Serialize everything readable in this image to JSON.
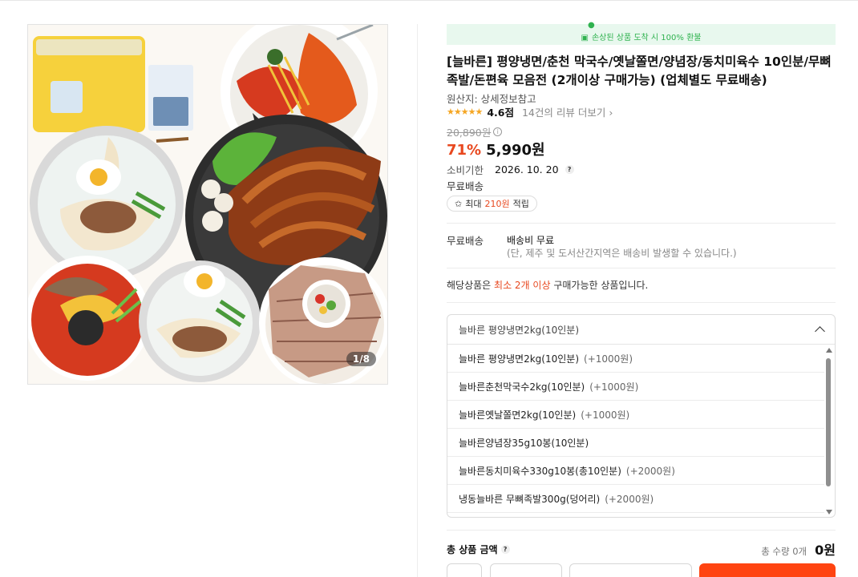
{
  "banner": {
    "text": "손상된 상품 도착 시 100% 환불",
    "icon": "bag-icon"
  },
  "product": {
    "title": "[늘바른] 평양냉면/춘천 막국수/옛날쫄면/양념장/동치미육수 10인분/무뼈 족발/돈편육 모음전 (2개이상 구매가능) (업체별도 무료배송)",
    "origin": "원산지: 상세정보참고",
    "rating": "4.6점",
    "rating_value": 4.6,
    "reviews": "14건의 리뷰 더보기",
    "original_price": "20,890원",
    "discount": "71%",
    "price": "5,990원",
    "expiry_label": "소비기한",
    "expiry_value": "2026. 10. 20",
    "free_shipping": "무료배송",
    "points_prefix": "최대",
    "points_amount": "210원",
    "points_suffix": "적립"
  },
  "gallery": {
    "counter": "1/8"
  },
  "shipping": {
    "label": "무료배송",
    "fee": "배송비 무료",
    "note": "(단, 제주 및 도서산간지역은 배송비 발생할 수 있습니다.)"
  },
  "min_notice": {
    "prefix": "해당상품은",
    "highlight": "최소 2개 이상",
    "suffix": "구매가능한 상품입니다."
  },
  "option_select": {
    "selected": "늘바른 평양냉면2kg(10인분)",
    "options": [
      {
        "label": "늘바른 평양냉면2kg(10인분)",
        "extra": "(+1000원)"
      },
      {
        "label": "늘바른춘천막국수2kg(10인분)",
        "extra": "(+1000원)"
      },
      {
        "label": "늘바른옛날쫄면2kg(10인분)",
        "extra": "(+1000원)"
      },
      {
        "label": "늘바른양념장35g10봉(10인분)",
        "extra": ""
      },
      {
        "label": "늘바른동치미육수330g10봉(총10인분)",
        "extra": "(+2000원)"
      },
      {
        "label": "냉동늘바른 무뼈족발300g(덩어리)",
        "extra": "(+2000원)"
      }
    ]
  },
  "total": {
    "label": "총 상품 금액",
    "qty": "총 수량 0개",
    "amount": "0원"
  },
  "colors": {
    "accent": "#e8481f",
    "buy": "#ff4411",
    "banner_text": "#2fb24f",
    "banner_bg": "#e8f8ee"
  }
}
